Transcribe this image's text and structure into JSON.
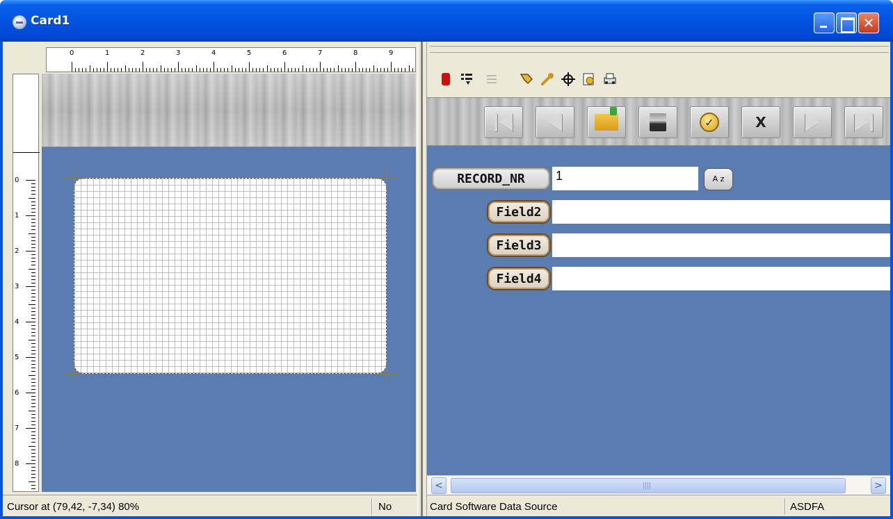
{
  "window": {
    "title": "Card1"
  },
  "rulers": {
    "horizontal_labels": [
      "0",
      "1",
      "2",
      "3",
      "4",
      "5",
      "6",
      "7",
      "8",
      "9"
    ],
    "vertical_labels": [
      "0",
      "1",
      "2",
      "3",
      "4",
      "5",
      "6",
      "7",
      "8"
    ]
  },
  "toolbar": {
    "icons": [
      "record-icon",
      "list-icon",
      "separator-list-icon",
      "tag-icon",
      "wrench-icon",
      "crosshair-icon",
      "export-icon",
      "print-icon"
    ]
  },
  "navigator": {
    "buttons": [
      "first-record-button",
      "previous-record-button",
      "insert-record-button",
      "post-record-button",
      "refresh-button",
      "delete-record-button",
      "next-record-button",
      "last-record-button"
    ],
    "delete_label": "X",
    "check_label": "✓"
  },
  "form": {
    "fields": [
      {
        "label": "RECORD_NR",
        "value": "1"
      },
      {
        "label": "Field2",
        "value": ""
      },
      {
        "label": "Field3",
        "value": ""
      },
      {
        "label": "Field4",
        "value": ""
      }
    ],
    "sort_label": "A z"
  },
  "scrollbar": {
    "left_arrow": "<",
    "right_arrow": ">"
  },
  "status": {
    "cursor": "Cursor at (79,42, -7,34) 80%",
    "mode": "No",
    "data_source": "Card Software Data Source",
    "database": "ASDFA"
  },
  "colors": {
    "canvas_blue": "#5b7cb1",
    "titlebar_blue": "#0054e3",
    "client_bg": "#ece9d8"
  }
}
